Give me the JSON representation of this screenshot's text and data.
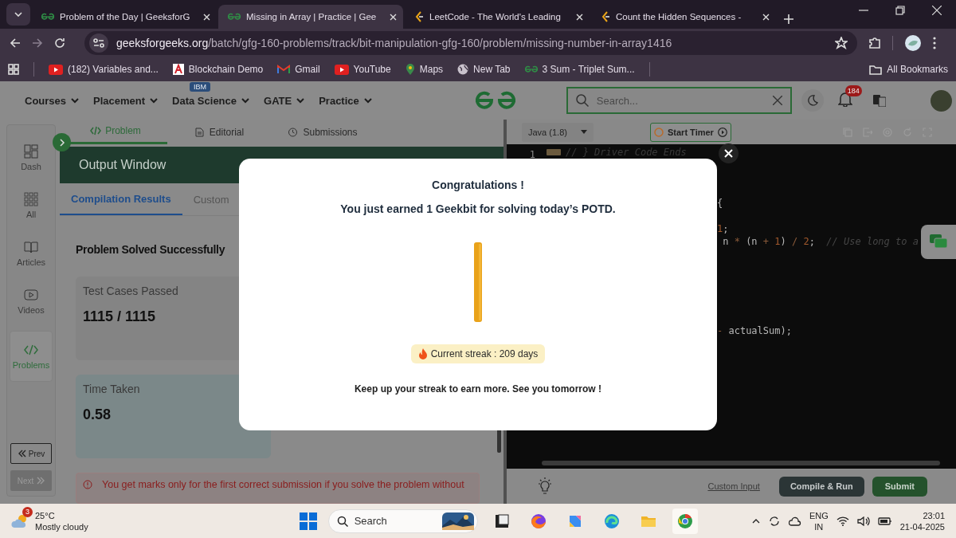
{
  "browser": {
    "tabs": [
      {
        "title": "Problem of the Day | GeeksforG",
        "kind": "gfg",
        "selected": false
      },
      {
        "title": "Missing in Array | Practice | Gee",
        "kind": "gfg",
        "selected": true
      },
      {
        "title": "LeetCode - The World's Leading",
        "kind": "leetcode",
        "selected": false
      },
      {
        "title": "Count the Hidden Sequences -",
        "kind": "leetcode",
        "selected": false
      }
    ],
    "address": {
      "host": "geeksforgeeks.org",
      "path": "/batch/gfg-160-problems/track/bit-manipulation-gfg-160/problem/missing-number-in-array1416"
    },
    "bookmarks": [
      {
        "label": "(182) Variables and...",
        "kind": "youtube"
      },
      {
        "label": "Blockchain Demo",
        "kind": "blockchain"
      },
      {
        "label": "Gmail",
        "kind": "gmail"
      },
      {
        "label": "YouTube",
        "kind": "youtube"
      },
      {
        "label": "Maps",
        "kind": "maps"
      },
      {
        "label": "New Tab",
        "kind": "globe"
      },
      {
        "label": "3 Sum - Triplet Sum...",
        "kind": "gfg"
      }
    ],
    "all_bookmarks": "All Bookmarks"
  },
  "header": {
    "nav": [
      {
        "label": "Courses"
      },
      {
        "label": "Placement"
      },
      {
        "label": "Data Science",
        "badge": "IBM"
      },
      {
        "label": "GATE"
      },
      {
        "label": "Practice"
      }
    ],
    "search": {
      "placeholder": "Search..."
    },
    "notification_count": "184"
  },
  "sidebar": {
    "items": [
      {
        "label": "Dash",
        "kind": "dash",
        "selected": false
      },
      {
        "label": "All",
        "kind": "all",
        "selected": false
      },
      {
        "label": "Articles",
        "kind": "articles",
        "selected": false
      },
      {
        "label": "Videos",
        "kind": "videos",
        "selected": false
      },
      {
        "label": "Problems",
        "kind": "problems",
        "selected": true
      }
    ],
    "prev": {
      "label": "Prev",
      "disabled": false
    },
    "next": {
      "label": "Next",
      "disabled": true
    }
  },
  "problem_tabs": [
    {
      "label": "Problem",
      "kind": "code",
      "selected": true
    },
    {
      "label": "Editorial",
      "kind": "doc",
      "selected": false
    },
    {
      "label": "Submissions",
      "kind": "clock",
      "selected": false
    }
  ],
  "output": {
    "title": "Output Window",
    "tabs": [
      {
        "label": "Compilation Results",
        "selected": true
      },
      {
        "label": "Custom",
        "selected": false
      }
    ],
    "status": "Problem Solved Successfully",
    "cards": [
      {
        "label": "Test Cases Passed",
        "value": "1115 / 1115",
        "kind": "tests"
      },
      {
        "label": "Time Taken",
        "value": "0.58",
        "kind": "time"
      }
    ],
    "warning": "You get marks only for the first correct submission if you solve the problem without"
  },
  "editor": {
    "language": "Java (1.8)",
    "timer_button": "Start Timer",
    "line_number": "1",
    "lines": [
      {
        "kind": "comment",
        "text": "// } Driver Code Ends"
      },
      {
        "kind": "blank"
      },
      {
        "kind": "blank"
      },
      {
        "kind": "blank"
      },
      {
        "kind": "fragment",
        "tokens": [
          {
            "t": "{",
            "kind": "plain"
          }
        ]
      },
      {
        "kind": "blank"
      },
      {
        "kind": "fragment",
        "tokens": [
          {
            "t": "1",
            "kind": "number"
          },
          {
            "t": ";",
            "kind": "plain"
          }
        ]
      },
      {
        "kind": "fragment",
        "tokens": [
          {
            "t": " n ",
            "kind": "plain"
          },
          {
            "t": "*",
            "kind": "op"
          },
          {
            "t": " (n ",
            "kind": "plain"
          },
          {
            "t": "+",
            "kind": "op"
          },
          {
            "t": " 1",
            "kind": "number"
          },
          {
            "t": ") ",
            "kind": "plain"
          },
          {
            "t": "/",
            "kind": "op"
          },
          {
            "t": " 2",
            "kind": "number"
          },
          {
            "t": ";  ",
            "kind": "plain"
          },
          {
            "t": "// Use long to a",
            "kind": "comment"
          }
        ]
      },
      {
        "kind": "blank"
      },
      {
        "kind": "blank"
      },
      {
        "kind": "blank"
      },
      {
        "kind": "blank"
      },
      {
        "kind": "blank"
      },
      {
        "kind": "blank"
      },
      {
        "kind": "fragment",
        "tokens": [
          {
            "t": "-",
            "kind": "op"
          },
          {
            "t": " actualSum);",
            "kind": "plain"
          }
        ]
      }
    ],
    "custom_input": "Custom Input",
    "compile": "Compile & Run",
    "submit": "Submit"
  },
  "modal": {
    "title": "Congratulations !",
    "message": "You just earned 1 Geekbit for solving today’s POTD.",
    "streak": "Current streak : 209 days",
    "footer": "Keep up your streak to earn more. See you tomorrow !"
  },
  "taskbar": {
    "weather": {
      "badge": "3",
      "temperature": "25°C",
      "condition": "Mostly cloudy"
    },
    "search": "Search",
    "language": "ENG",
    "region": "IN",
    "time": "23:01",
    "date": "21-04-2025"
  }
}
